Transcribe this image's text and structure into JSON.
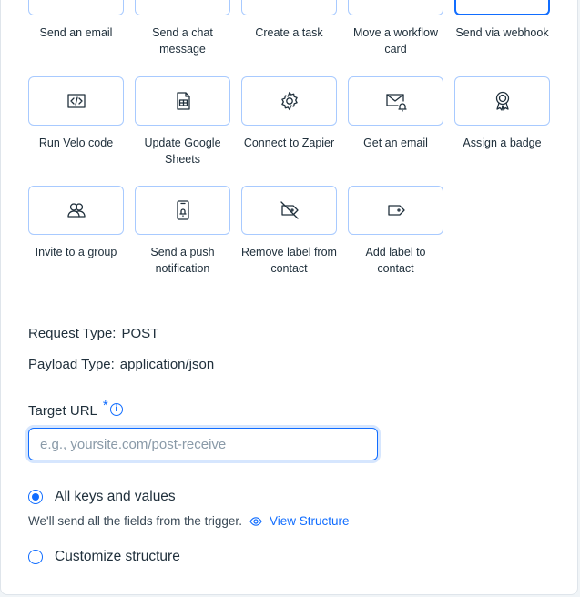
{
  "actions": [
    {
      "label": "Send an email",
      "icon": "email-icon",
      "selected": false
    },
    {
      "label": "Send a chat message",
      "icon": "chat-icon",
      "selected": false
    },
    {
      "label": "Create a task",
      "icon": "task-icon",
      "selected": false
    },
    {
      "label": "Move a workflow card",
      "icon": "workflow-card-icon",
      "selected": false
    },
    {
      "label": "Send via webhook",
      "icon": "webhook-icon",
      "selected": true
    },
    {
      "label": "Run Velo code",
      "icon": "code-icon",
      "selected": false
    },
    {
      "label": "Update Google Sheets",
      "icon": "spreadsheet-icon",
      "selected": false
    },
    {
      "label": "Connect to Zapier",
      "icon": "gear-icon",
      "selected": false
    },
    {
      "label": "Get an email",
      "icon": "email-bell-icon",
      "selected": false
    },
    {
      "label": "Assign a badge",
      "icon": "badge-icon",
      "selected": false
    },
    {
      "label": "Invite to a group",
      "icon": "group-icon",
      "selected": false
    },
    {
      "label": "Send a push notification",
      "icon": "push-notification-icon",
      "selected": false
    },
    {
      "label": "Remove label from contact",
      "icon": "remove-label-icon",
      "selected": false
    },
    {
      "label": "Add label to contact",
      "icon": "label-icon",
      "selected": false
    }
  ],
  "request": {
    "type_key": "Request Type:",
    "type_value": "POST"
  },
  "payload": {
    "type_key": "Payload Type:",
    "type_value": "application/json"
  },
  "target_url": {
    "label": "Target URL",
    "required_mark": "*",
    "placeholder": "e.g., yoursite.com/post-receive",
    "value": ""
  },
  "structure": {
    "all_label": "All keys and values",
    "all_selected": true,
    "hint": "We'll send all the fields from the trigger.",
    "view_link": "View Structure",
    "custom_label": "Customize structure",
    "custom_selected": false
  },
  "colors": {
    "accent": "#116dff",
    "tile_border": "#a8caff"
  }
}
